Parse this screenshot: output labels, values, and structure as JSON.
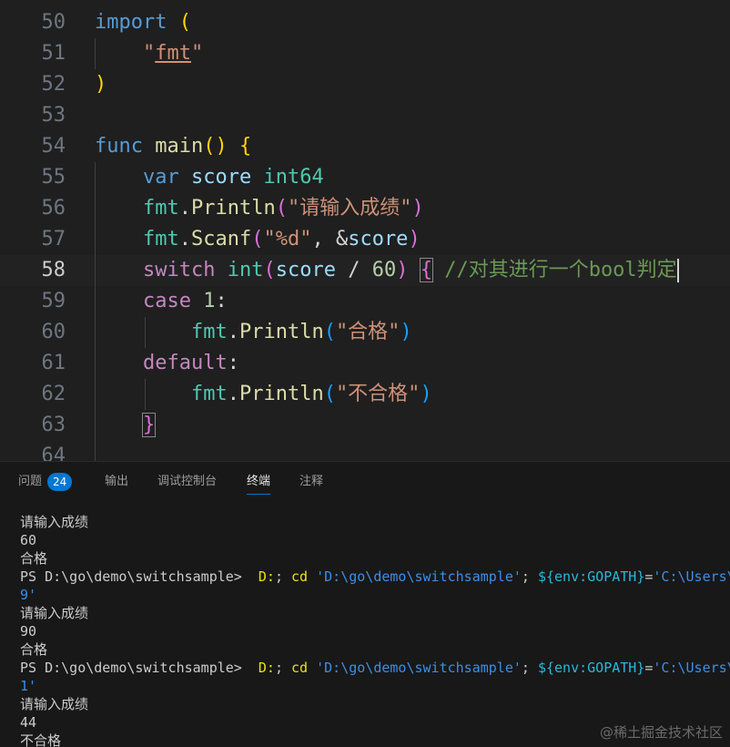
{
  "editor": {
    "line_numbers": [
      "50",
      "51",
      "52",
      "53",
      "54",
      "55",
      "56",
      "57",
      "58",
      "59",
      "60",
      "61",
      "62",
      "63",
      "64"
    ],
    "current_line": "58",
    "tokens": {
      "l50_import": "import",
      "l50_paren": "(",
      "l51_q1": "\"",
      "l51_fmt": "fmt",
      "l51_q2": "\"",
      "l52_paren": ")",
      "l54_func": "func",
      "l54_main": "main",
      "l54_parens": "()",
      "l54_brace": "{",
      "l55_var": "var",
      "l55_score": "score",
      "l55_type": "int64",
      "l56_fmt": "fmt",
      "l56_dot": ".",
      "l56_fn": "Println",
      "l56_open": "(",
      "l56_str": "\"请输入成绩\"",
      "l56_close": ")",
      "l57_fmt": "fmt",
      "l57_dot": ".",
      "l57_fn": "Scanf",
      "l57_open": "(",
      "l57_str": "\"%d\"",
      "l57_mid": ", &",
      "l57_score": "score",
      "l57_close": ")",
      "l58_switch": "switch",
      "l58_int": "int",
      "l58_open": "(",
      "l58_score": "score",
      "l58_div": " / ",
      "l58_num": "60",
      "l58_close": ")",
      "l58_brace": "{",
      "l58_comment": "//对其进行一个bool判定",
      "l59_case": "case",
      "l59_num": "1",
      "l59_colon": ":",
      "l60_fmt": "fmt",
      "l60_dot": ".",
      "l60_fn": "Println",
      "l60_open": "(",
      "l60_str": "\"合格\"",
      "l60_close": ")",
      "l61_default": "default",
      "l61_colon": ":",
      "l62_fmt": "fmt",
      "l62_dot": ".",
      "l62_fn": "Println",
      "l62_open": "(",
      "l62_str": "\"不合格\"",
      "l62_close": ")",
      "l63_brace": "}"
    }
  },
  "panel": {
    "tabs": [
      {
        "label": "问题",
        "badge": "24"
      },
      {
        "label": "输出"
      },
      {
        "label": "调试控制台"
      },
      {
        "label": "终端",
        "active": true
      },
      {
        "label": "注释"
      }
    ]
  },
  "terminal": {
    "prompt": "PS D:\\go\\demo\\switchsample>",
    "cmd_drive": "D:",
    "cmd_sep1": ";",
    "cmd_cd": "cd",
    "cmd_path": "'D:\\go\\demo\\switchsample'",
    "cmd_sep2": ";",
    "cmd_env": "${env:GOPATH}",
    "cmd_eq": "=",
    "cmd_val": "'C:\\Users\\",
    "run1": [
      "请输入成绩",
      "60",
      "合格"
    ],
    "wrap1": "9'",
    "run2": [
      "请输入成绩",
      "90",
      "合格"
    ],
    "wrap2": "1'",
    "run3": [
      "请输入成绩",
      "44",
      "不合格"
    ]
  },
  "watermark": "@稀土掘金技术社区",
  "colors": {
    "editor_bg": "#1f1f1f",
    "panel_bg": "#181818",
    "accent": "#0078d4"
  }
}
